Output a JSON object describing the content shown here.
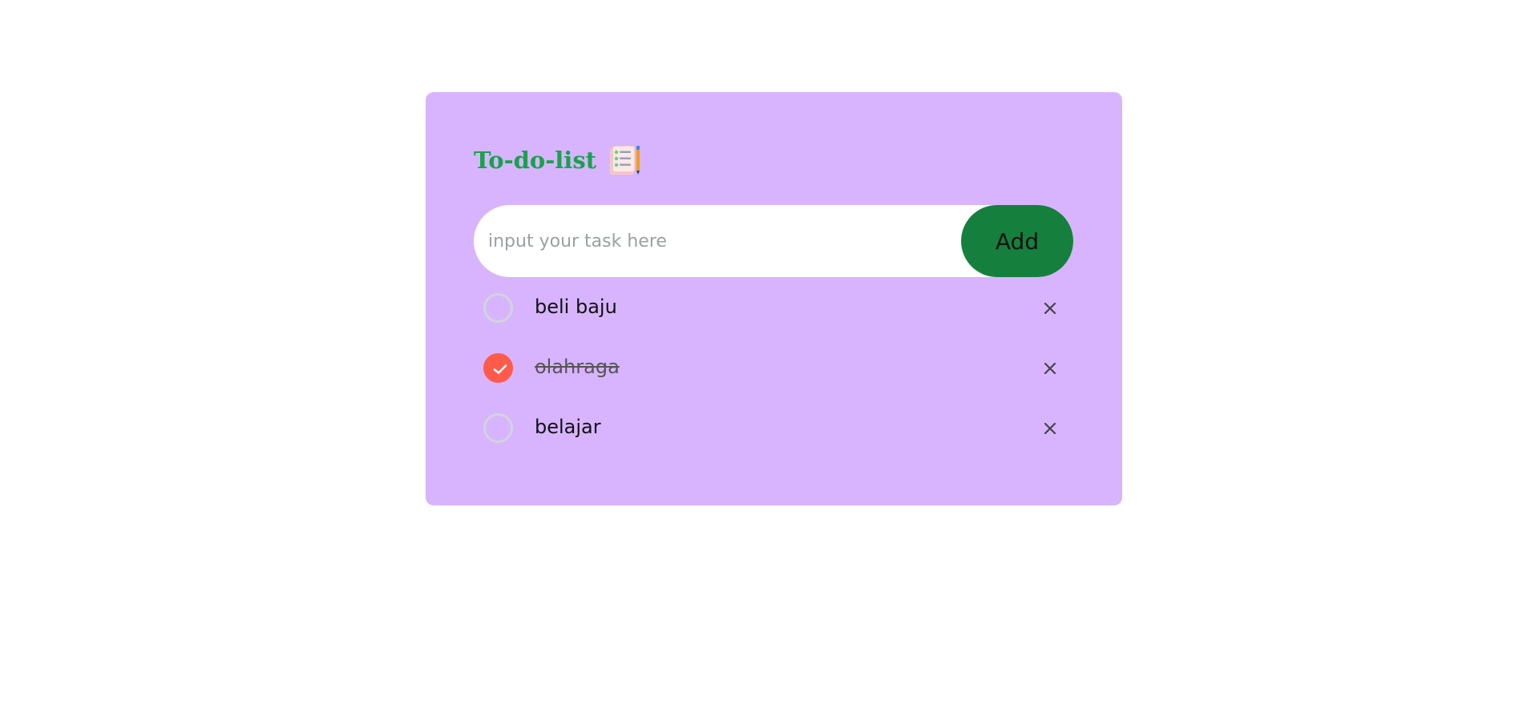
{
  "app": {
    "title": "To-do-list",
    "title_icon": "checklist-notebook-icon",
    "colors": {
      "card_background": "#d8b4fe",
      "title": "#16a34a",
      "add_button": "#15803d",
      "checked": "#ff5a4a"
    }
  },
  "input": {
    "placeholder": "input your task here",
    "value": ""
  },
  "add_button": {
    "label": "Add"
  },
  "tasks": [
    {
      "label": "beli baju",
      "completed": false
    },
    {
      "label": "olahraga",
      "completed": true
    },
    {
      "label": "belajar",
      "completed": false
    }
  ],
  "icons": {
    "check": "check-icon",
    "delete": "close-icon"
  }
}
